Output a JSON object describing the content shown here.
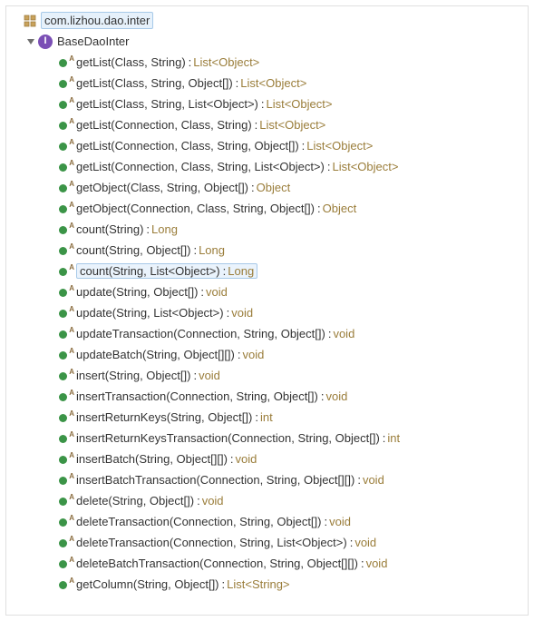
{
  "package": {
    "name": "com.lizhou.dao.inter",
    "selected": true
  },
  "interface": {
    "name": "BaseDaoInter",
    "expanded": true
  },
  "methods": [
    {
      "sig": "getList(Class, String)",
      "ret": "List<Object>",
      "selected": false
    },
    {
      "sig": "getList(Class, String, Object[])",
      "ret": "List<Object>",
      "selected": false
    },
    {
      "sig": "getList(Class, String, List<Object>)",
      "ret": "List<Object>",
      "selected": false
    },
    {
      "sig": "getList(Connection, Class, String)",
      "ret": "List<Object>",
      "selected": false
    },
    {
      "sig": "getList(Connection, Class, String, Object[])",
      "ret": "List<Object>",
      "selected": false
    },
    {
      "sig": "getList(Connection, Class, String, List<Object>)",
      "ret": "List<Object>",
      "selected": false
    },
    {
      "sig": "getObject(Class, String, Object[])",
      "ret": "Object",
      "selected": false
    },
    {
      "sig": "getObject(Connection, Class, String, Object[])",
      "ret": "Object",
      "selected": false
    },
    {
      "sig": "count(String)",
      "ret": "Long",
      "selected": false
    },
    {
      "sig": "count(String, Object[])",
      "ret": "Long",
      "selected": false
    },
    {
      "sig": "count(String, List<Object>)",
      "ret": "Long",
      "selected": true
    },
    {
      "sig": "update(String, Object[])",
      "ret": "void",
      "selected": false
    },
    {
      "sig": "update(String, List<Object>)",
      "ret": "void",
      "selected": false
    },
    {
      "sig": "updateTransaction(Connection, String, Object[])",
      "ret": "void",
      "selected": false
    },
    {
      "sig": "updateBatch(String, Object[][])",
      "ret": "void",
      "selected": false
    },
    {
      "sig": "insert(String, Object[])",
      "ret": "void",
      "selected": false
    },
    {
      "sig": "insertTransaction(Connection, String, Object[])",
      "ret": "void",
      "selected": false
    },
    {
      "sig": "insertReturnKeys(String, Object[])",
      "ret": "int",
      "selected": false
    },
    {
      "sig": "insertReturnKeysTransaction(Connection, String, Object[])",
      "ret": "int",
      "selected": false
    },
    {
      "sig": "insertBatch(String, Object[][])",
      "ret": "void",
      "selected": false
    },
    {
      "sig": "insertBatchTransaction(Connection, String, Object[][])",
      "ret": "void",
      "selected": false
    },
    {
      "sig": "delete(String, Object[])",
      "ret": "void",
      "selected": false
    },
    {
      "sig": "deleteTransaction(Connection, String, Object[])",
      "ret": "void",
      "selected": false
    },
    {
      "sig": "deleteTransaction(Connection, String, List<Object>)",
      "ret": "void",
      "selected": false
    },
    {
      "sig": "deleteBatchTransaction(Connection, String, Object[][])",
      "ret": "void",
      "selected": false
    },
    {
      "sig": "getColumn(String, Object[])",
      "ret": "List<String>",
      "selected": false
    }
  ]
}
